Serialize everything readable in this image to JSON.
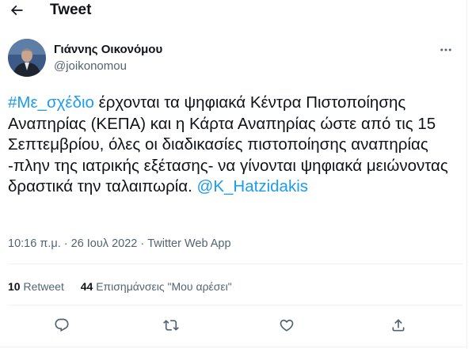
{
  "header": {
    "title": "Tweet"
  },
  "author": {
    "name": "Γιάννης Οικονόμου",
    "handle": "@joikonomou"
  },
  "tweet": {
    "hashtag": "#Με_σχέδιο",
    "body": " έρχονται τα ψηφιακά Κέντρα Πιστοποίησης Αναπηρίας (ΚΕΠΑ) και η Κάρτα Αναπηρίας ώστε από τις 15 Σεπτεμβρίου, όλες οι διαδικασίες πιστοποίησης αναπηρίας -πλην της ιατρικής εξέτασης- να γίνονται ψηφιακά μειώνοντας δραστικά την ταλαιπωρία. ",
    "mention": "@K_Hatzidakis"
  },
  "meta": {
    "time": "10:16 π.μ.",
    "separator": " · ",
    "date": "26 Ιουλ 2022",
    "source": "Twitter Web App"
  },
  "stats": {
    "retweets_count": "10",
    "retweets_label": "Retweet",
    "likes_count": "44",
    "likes_label": "Επισημάνσεις \"Μου αρέσει\""
  },
  "icons": [
    "back-arrow-icon",
    "more-icon",
    "reply-icon",
    "retweet-icon",
    "like-icon",
    "share-icon"
  ],
  "colors": {
    "accent": "#1d9bf0",
    "text": "#0f1419",
    "secondary": "#536471",
    "divider": "#eff3f4"
  }
}
